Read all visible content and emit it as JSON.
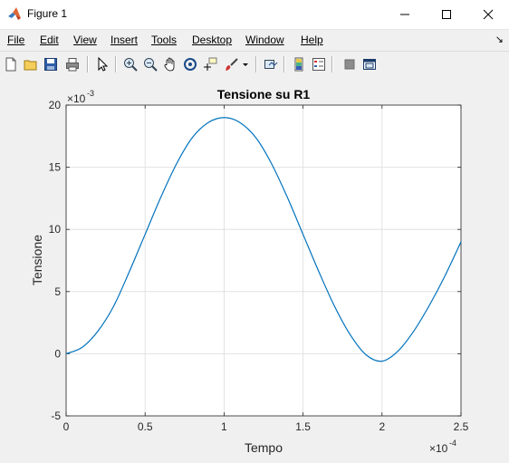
{
  "window": {
    "title": "Figure 1"
  },
  "menu": [
    "File",
    "Edit",
    "View",
    "Insert",
    "Tools",
    "Desktop",
    "Window",
    "Help"
  ],
  "toolbar_icons": [
    "new-figure-icon",
    "open-file-icon",
    "save-icon",
    "print-icon",
    "pointer-icon",
    "zoom-in-icon",
    "zoom-out-icon",
    "pan-icon",
    "rotate-3d-icon",
    "data-cursor-icon",
    "brush-icon",
    "brush-dropdown-icon",
    "link-plot-icon",
    "insert-colorbar-icon",
    "insert-legend-icon",
    "hide-plot-tools-icon",
    "show-plot-tools-icon"
  ],
  "colors": {
    "line": "#0072bd",
    "axes_bg": "#ffffff",
    "figure_bg": "#f0f0f0",
    "grid": "#dcdcdc"
  },
  "chart_data": {
    "type": "line",
    "title": "Tensione su R1",
    "xlabel": "Tempo",
    "ylabel": "Tensione",
    "x_exponent": "-4",
    "y_exponent": "-3",
    "xlim": [
      0,
      2.5
    ],
    "ylim": [
      -5,
      20
    ],
    "xticks": [
      0,
      0.5,
      1,
      1.5,
      2,
      2.5
    ],
    "xtick_labels": [
      "0",
      "0.5",
      "1",
      "1.5",
      "2",
      "2.5"
    ],
    "yticks": [
      -5,
      0,
      5,
      10,
      15,
      20
    ],
    "ytick_labels": [
      "-5",
      "0",
      "5",
      "10",
      "15",
      "20"
    ],
    "grid": true,
    "series": [
      {
        "x": [
          0,
          0.1,
          0.2,
          0.3,
          0.4,
          0.5,
          0.6,
          0.7,
          0.8,
          0.9,
          1.0,
          1.1,
          1.2,
          1.3,
          1.4,
          1.5,
          1.6,
          1.7,
          1.8,
          1.9,
          2.0,
          2.1,
          2.2,
          2.3,
          2.4,
          2.5
        ],
        "y": [
          0,
          0.5,
          1.8,
          3.8,
          6.6,
          9.6,
          12.6,
          15.3,
          17.4,
          18.6,
          19.0,
          18.6,
          17.4,
          15.3,
          12.6,
          9.6,
          6.6,
          3.8,
          1.5,
          -0.1,
          -0.6,
          0.2,
          1.8,
          3.9,
          6.3,
          9.0
        ]
      }
    ]
  }
}
